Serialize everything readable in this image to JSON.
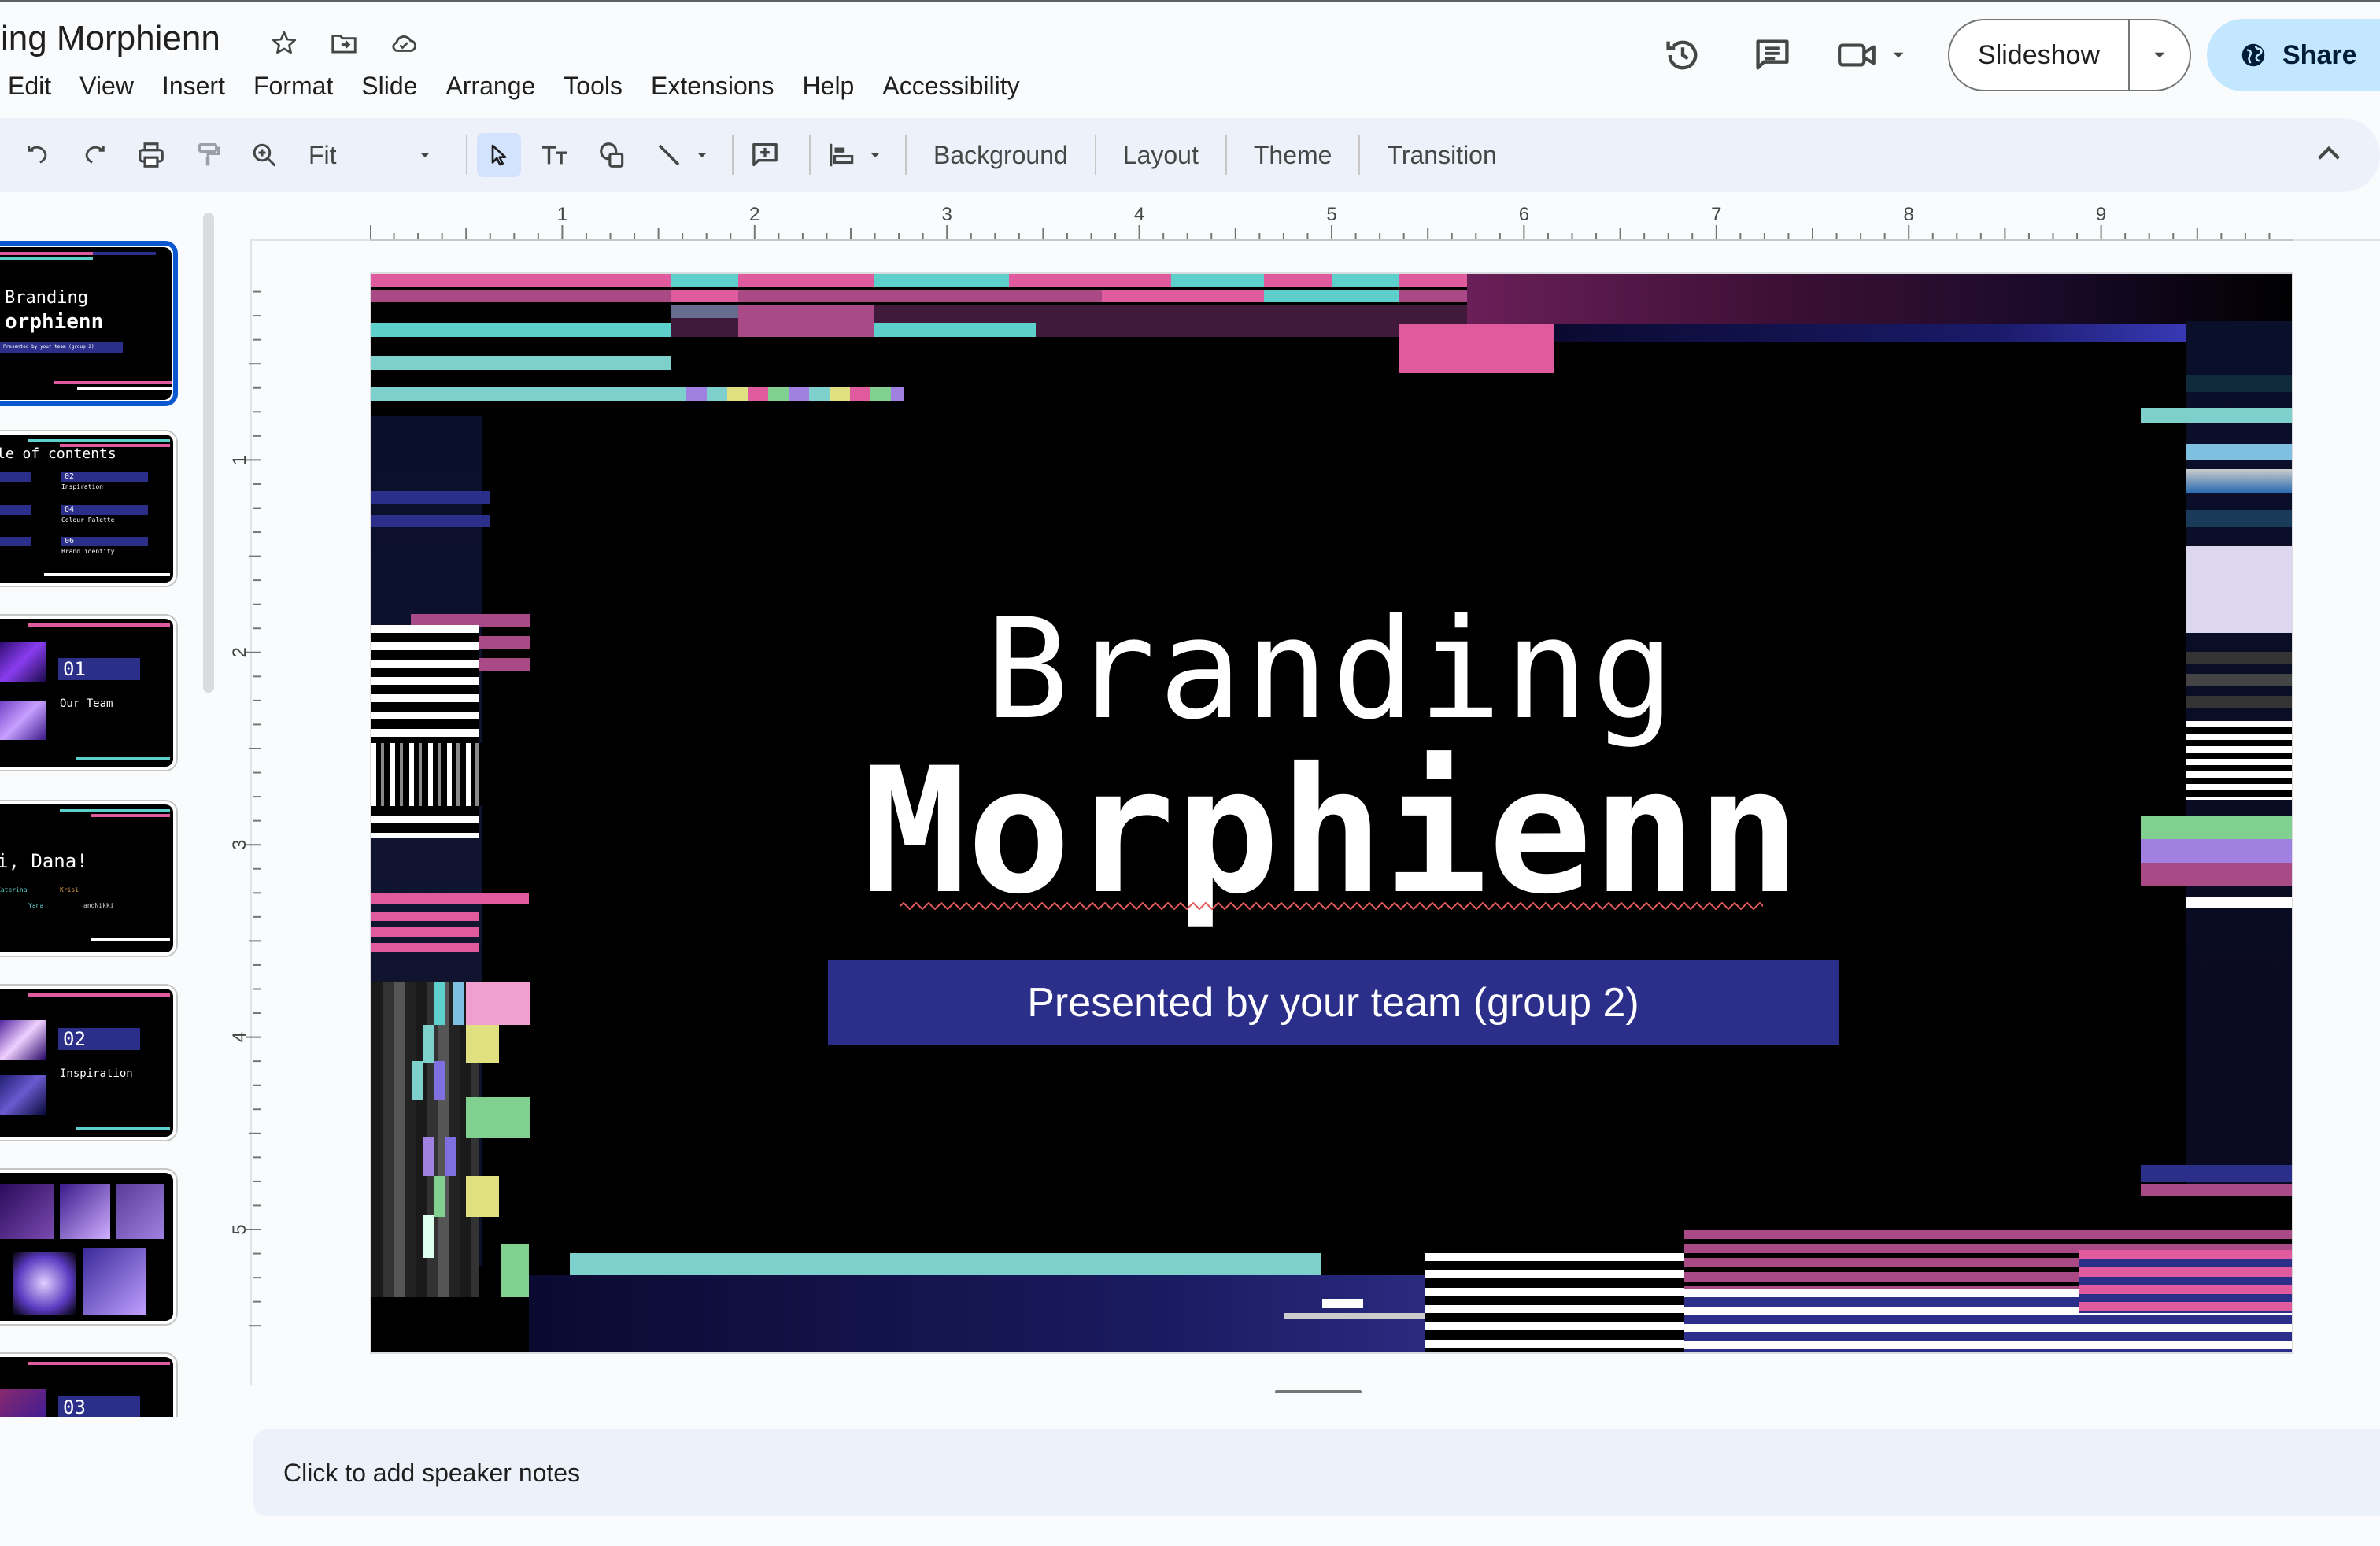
{
  "doc": {
    "title": "Branding Morphienn",
    "title_visible": "nding Morphienn"
  },
  "menu": [
    "Edit",
    "View",
    "Insert",
    "Format",
    "Slide",
    "Arrange",
    "Tools",
    "Extensions",
    "Help",
    "Accessibility"
  ],
  "header": {
    "slideshow_label": "Slideshow",
    "share_label": "Share"
  },
  "toolbar": {
    "zoom_value": "Fit",
    "background_label": "Background",
    "layout_label": "Layout",
    "theme_label": "Theme",
    "transition_label": "Transition"
  },
  "ruler": {
    "h_labels": [
      "1",
      "2",
      "3",
      "4",
      "5",
      "6",
      "7",
      "8",
      "9"
    ],
    "v_labels": [
      "1",
      "2",
      "3",
      "4",
      "5"
    ]
  },
  "thumbnails": [
    {
      "line1": "Branding",
      "line2": "orphienn",
      "sub": "Presented by your team (group 2)"
    },
    {
      "line1": "le of contents",
      "items": [
        "02",
        "Inspiration",
        "04",
        "Colour Palette",
        "06",
        "Brand identity"
      ]
    },
    {
      "num": "01",
      "label": "Our Team"
    },
    {
      "line1": "i, Dana!",
      "names": [
        "Katerina",
        "Krisi",
        "Yana",
        "andNikki"
      ]
    },
    {
      "num": "02",
      "label": "Inspiration"
    },
    {
      "label": ""
    },
    {
      "num": "03"
    }
  ],
  "slide": {
    "title_line1": "Branding",
    "title_line2": "Morphienn",
    "subtitle": "Presented by your team (group 2)"
  },
  "notes": {
    "placeholder": "Click to add speaker notes"
  },
  "colors": {
    "accent_blue": "#0b57d0",
    "share_bg": "#c2e7ff",
    "toolbar_bg": "#edf2fa",
    "slide_pink": "#e05a9e",
    "slide_teal": "#5ed0cc",
    "slide_navy": "#2b2f8a"
  }
}
